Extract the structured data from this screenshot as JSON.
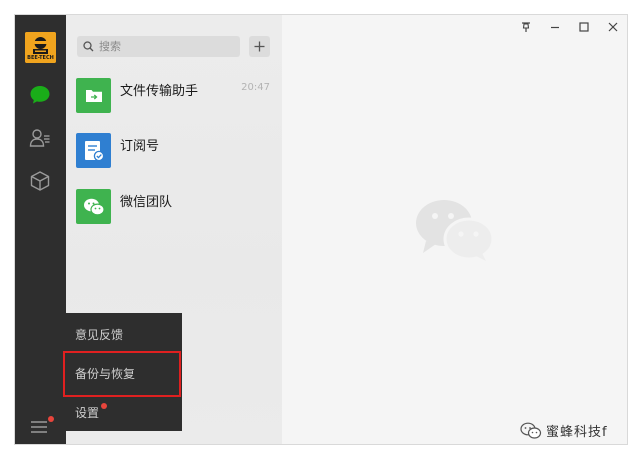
{
  "avatar": {
    "label": "BEE-TECH"
  },
  "search": {
    "placeholder": "搜索"
  },
  "chats": [
    {
      "name": "文件传输助手",
      "time": "20:47",
      "color": "#3fb34f",
      "icon": "folder-arrow-icon"
    },
    {
      "name": "订阅号",
      "time": "",
      "color": "#2f7fd1",
      "icon": "document-check-icon"
    },
    {
      "name": "微信团队",
      "time": "",
      "color": "#3fb34f",
      "icon": "wechat-logo-icon"
    }
  ],
  "popup_menu": {
    "items": [
      {
        "label": "意见反馈"
      },
      {
        "label": "备份与恢复"
      },
      {
        "label": "设置"
      }
    ]
  },
  "watermark": {
    "text": "蜜蜂科技f"
  },
  "colors": {
    "rail": "#2e2e2e",
    "accent_green": "#1aad19",
    "badge_red": "#e8453c",
    "highlight_red": "#e02020"
  }
}
